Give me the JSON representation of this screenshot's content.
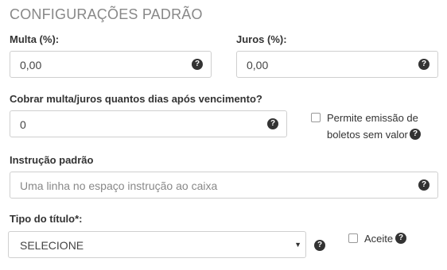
{
  "section": {
    "title": "CONFIGURAÇÕES PADRÃO"
  },
  "multa": {
    "label": "Multa (%):",
    "value": "0,00"
  },
  "juros": {
    "label": "Juros (%):",
    "value": "0,00"
  },
  "dias": {
    "label": "Cobrar multa/juros quantos dias após vencimento?",
    "value": "0"
  },
  "emissao": {
    "line1": "Permite emissão de",
    "line2": "boletos sem valor"
  },
  "instrucao": {
    "label": "Instrução padrão",
    "placeholder": "Uma linha no espaço instrução ao caixa"
  },
  "tipo": {
    "label": "Tipo do título*:",
    "selected": "SELECIONE"
  },
  "aceite": {
    "label": "Aceite"
  },
  "icons": {
    "help": "question-circle-icon",
    "help_glyph": "?"
  }
}
